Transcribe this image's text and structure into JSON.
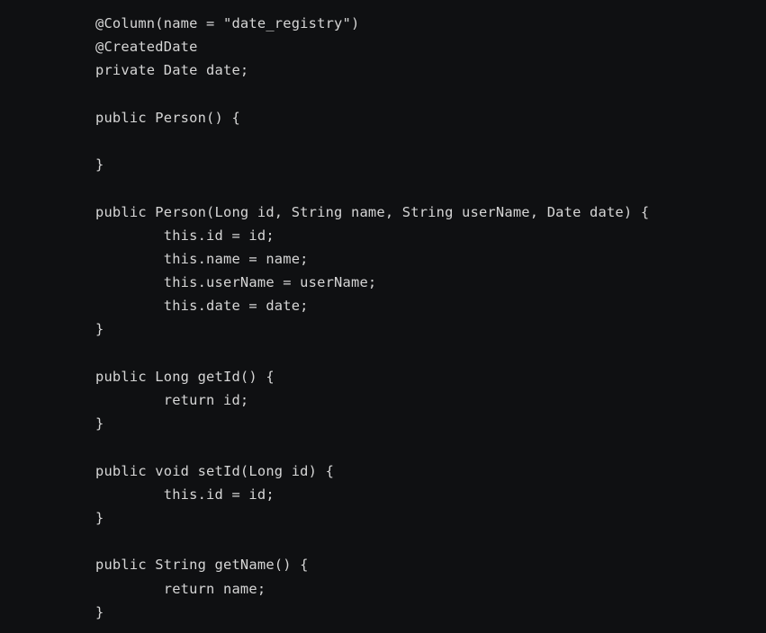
{
  "editor": {
    "colors": {
      "background": "#0f1012",
      "text": "#d6d6d6"
    },
    "lines": [
      "@Column(name = \"date_registry\")",
      "@CreatedDate",
      "private Date date;",
      "",
      "public Person() {",
      "",
      "}",
      "",
      "public Person(Long id, String name, String userName, Date date) {",
      "        this.id = id;",
      "        this.name = name;",
      "        this.userName = userName;",
      "        this.date = date;",
      "}",
      "",
      "public Long getId() {",
      "        return id;",
      "}",
      "",
      "public void setId(Long id) {",
      "        this.id = id;",
      "}",
      "",
      "public String getName() {",
      "        return name;",
      "}"
    ]
  }
}
